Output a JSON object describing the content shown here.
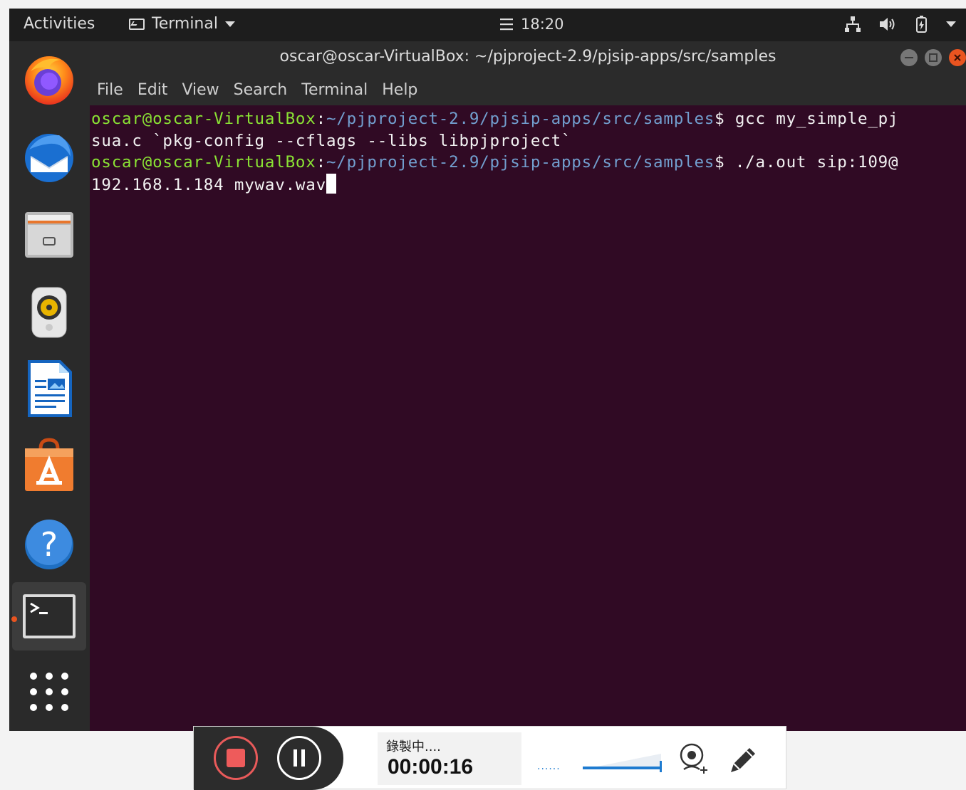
{
  "topbar": {
    "activities": "Activities",
    "app_name": "Terminal",
    "time": "18:20"
  },
  "window": {
    "title": "oscar@oscar-VirtualBox: ~/pjproject-2.9/pjsip-apps/src/samples",
    "menu": [
      "File",
      "Edit",
      "View",
      "Search",
      "Terminal",
      "Help"
    ]
  },
  "terminal": {
    "lines": [
      {
        "user": "oscar@oscar-VirtualBox",
        "path": "~/pjproject-2.9/pjsip-apps/src/samples",
        "cmd": "$ gcc my_simple_pj"
      },
      {
        "text": "sua.c `pkg-config --cflags --libs libpjproject`"
      },
      {
        "user": "oscar@oscar-VirtualBox",
        "path": "~/pjproject-2.9/pjsip-apps/src/samples",
        "cmd": "$ ./a.out sip:109@"
      },
      {
        "text": "192.168.1.184 mywav.wav"
      }
    ]
  },
  "dock": {
    "items": [
      "firefox-icon",
      "thunderbird-icon",
      "files-icon",
      "rhythmbox-icon",
      "libreoffice-writer-icon",
      "software-center-icon",
      "help-icon",
      "terminal-icon",
      "show-apps-icon"
    ]
  },
  "recorder": {
    "status": "錄製中....",
    "timer": "00:00:16",
    "dots": "......"
  },
  "colors": {
    "terminal_bg": "#300a24",
    "prompt_user": "#8ae234",
    "prompt_path": "#729fcf",
    "close_button": "#e95420"
  }
}
